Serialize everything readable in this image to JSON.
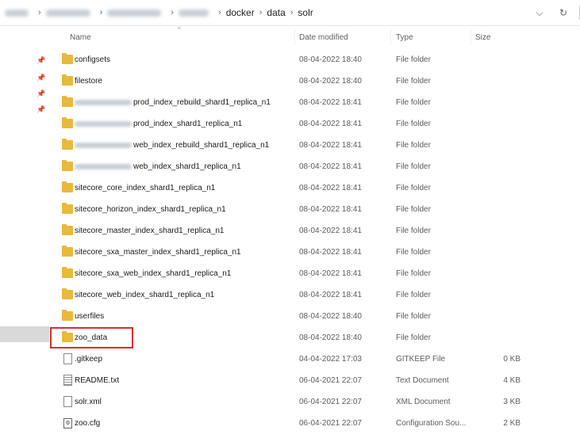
{
  "address": {
    "crumbs": [
      "docker",
      "data",
      "solr"
    ],
    "icons": [
      "chevron-down-icon",
      "refresh-icon"
    ]
  },
  "columns": {
    "name": "Name",
    "date": "Date modified",
    "type": "Type",
    "size": "Size"
  },
  "rows": [
    {
      "name": "configsets",
      "date": "08-04-2022 18:40",
      "type": "File folder",
      "size": "",
      "icon": "folder-icon"
    },
    {
      "name": "filestore",
      "date": "08-04-2022 18:40",
      "type": "File folder",
      "size": "",
      "icon": "folder-icon"
    },
    {
      "name": "prod_index_rebuild_shard1_replica_n1",
      "date": "08-04-2022 18:41",
      "type": "File folder",
      "size": "",
      "icon": "folder-icon"
    },
    {
      "name": "prod_index_shard1_replica_n1",
      "date": "08-04-2022 18:41",
      "type": "File folder",
      "size": "",
      "icon": "folder-icon"
    },
    {
      "name": "web_index_rebuild_shard1_replica_n1",
      "date": "08-04-2022 18:41",
      "type": "File folder",
      "size": "",
      "icon": "folder-icon"
    },
    {
      "name": "web_index_shard1_replica_n1",
      "date": "08-04-2022 18:41",
      "type": "File folder",
      "size": "",
      "icon": "folder-icon"
    },
    {
      "name": "sitecore_core_index_shard1_replica_n1",
      "date": "08-04-2022 18:41",
      "type": "File folder",
      "size": "",
      "icon": "folder-icon"
    },
    {
      "name": "sitecore_horizon_index_shard1_replica_n1",
      "date": "08-04-2022 18:41",
      "type": "File folder",
      "size": "",
      "icon": "folder-icon"
    },
    {
      "name": "sitecore_master_index_shard1_replica_n1",
      "date": "08-04-2022 18:41",
      "type": "File folder",
      "size": "",
      "icon": "folder-icon"
    },
    {
      "name": "sitecore_sxa_master_index_shard1_replica_n1",
      "date": "08-04-2022 18:41",
      "type": "File folder",
      "size": "",
      "icon": "folder-icon"
    },
    {
      "name": "sitecore_sxa_web_index_shard1_replica_n1",
      "date": "08-04-2022 18:41",
      "type": "File folder",
      "size": "",
      "icon": "folder-icon"
    },
    {
      "name": "sitecore_web_index_shard1_replica_n1",
      "date": "08-04-2022 18:41",
      "type": "File folder",
      "size": "",
      "icon": "folder-icon"
    },
    {
      "name": "userfiles",
      "date": "08-04-2022 18:40",
      "type": "File folder",
      "size": "",
      "icon": "folder-icon"
    },
    {
      "name": "zoo_data",
      "date": "08-04-2022 18:40",
      "type": "File folder",
      "size": "",
      "icon": "folder-icon"
    },
    {
      "name": ".gitkeep",
      "date": "04-04-2022 17:03",
      "type": "GITKEEP File",
      "size": "0 KB",
      "icon": "file-icon"
    },
    {
      "name": "README.txt",
      "date": "06-04-2021 22:07",
      "type": "Text Document",
      "size": "4 KB",
      "icon": "text-file-icon"
    },
    {
      "name": "solr.xml",
      "date": "06-04-2021 22:07",
      "type": "XML Document",
      "size": "3 KB",
      "icon": "file-icon"
    },
    {
      "name": "zoo.cfg",
      "date": "06-04-2021 22:07",
      "type": "Configuration Sou...",
      "size": "2 KB",
      "icon": "config-file-icon"
    }
  ]
}
